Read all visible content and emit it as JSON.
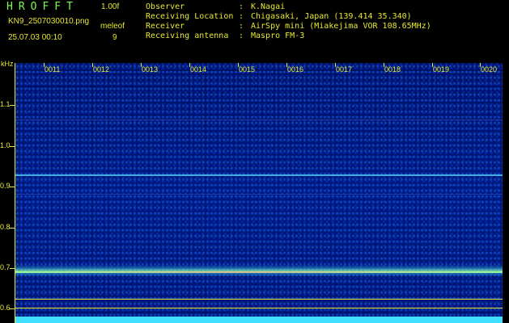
{
  "header": {
    "app_title": "HROFFT",
    "version": "1.00f",
    "filename": "KN9_2507030010.png",
    "timestamp": "25.07.03 00:10",
    "meleof_label": "meleof",
    "meleof_value": "9",
    "info": [
      {
        "key": "Observer",
        "value": "K.Nagai"
      },
      {
        "key": "Receiving Location",
        "value": "Chigasaki, Japan (139.414 35.340)"
      },
      {
        "key": "Receiver",
        "value": "AirSpy mini (Miakejima VOR 108.65MHz)"
      },
      {
        "key": "Receiving antenna",
        "value": "Maspro FM-3"
      }
    ]
  },
  "plot": {
    "y_unit": "kHz",
    "y_ticks": [
      "1.1",
      "1.0",
      "0.9",
      "0.8",
      "0.7",
      "0.6"
    ],
    "x_ticks": [
      "0011",
      "0012",
      "0013",
      "0014",
      "0015",
      "0016",
      "0017",
      "0018",
      "0019",
      "0020"
    ],
    "colors": {
      "label": "#E8E830",
      "title": "#7CFC4A",
      "background": "#001a7a",
      "carrier": "#60E0FF"
    }
  }
}
